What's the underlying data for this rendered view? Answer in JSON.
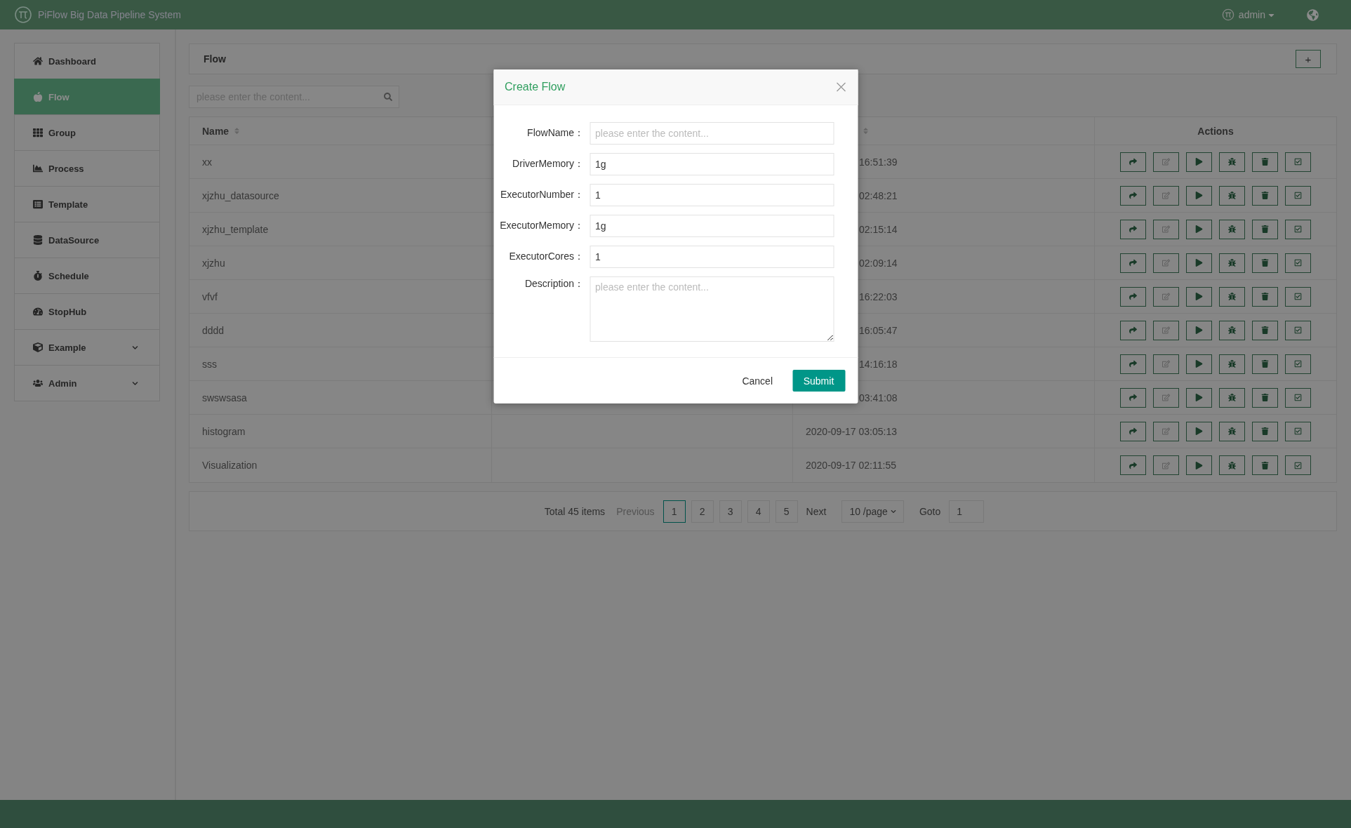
{
  "app": {
    "title": "PiFlow Big Data Pipeline System",
    "user": "admin"
  },
  "sidebar": {
    "items": [
      {
        "label": "Dashboard",
        "kind": "home",
        "selected": false,
        "expandable": false
      },
      {
        "label": "Flow",
        "kind": "flow",
        "selected": true,
        "expandable": false
      },
      {
        "label": "Group",
        "kind": "grid",
        "selected": false,
        "expandable": false
      },
      {
        "label": "Process",
        "kind": "chart",
        "selected": false,
        "expandable": false
      },
      {
        "label": "Template",
        "kind": "list",
        "selected": false,
        "expandable": false
      },
      {
        "label": "DataSource",
        "kind": "database",
        "selected": false,
        "expandable": false
      },
      {
        "label": "Schedule",
        "kind": "clock",
        "selected": false,
        "expandable": false
      },
      {
        "label": "StopHub",
        "kind": "gauge",
        "selected": false,
        "expandable": false
      },
      {
        "label": "Example",
        "kind": "cube",
        "selected": false,
        "expandable": true
      },
      {
        "label": "Admin",
        "kind": "users",
        "selected": false,
        "expandable": true
      }
    ]
  },
  "panel": {
    "title": "Flow",
    "add_button": "+"
  },
  "search": {
    "placeholder": "please enter the content..."
  },
  "table": {
    "columns": [
      {
        "label": "Name",
        "sortable": true
      },
      {
        "sortable": true
      },
      {
        "label": "Actions",
        "sortable": false
      }
    ],
    "row_actions": [
      {
        "kind": "share",
        "disabled": false
      },
      {
        "kind": "edit",
        "disabled": true
      },
      {
        "kind": "play",
        "disabled": false
      },
      {
        "kind": "bug",
        "disabled": false
      },
      {
        "kind": "trash",
        "disabled": false
      },
      {
        "kind": "check",
        "disabled": false
      }
    ],
    "rows": [
      {
        "name": "xx",
        "column_3": "16:51:39",
        "clipped": true
      },
      {
        "name": "xjzhu_datasource",
        "column_3": "02:48:21",
        "clipped": true
      },
      {
        "name": "xjzhu_template",
        "column_3": "02:15:14",
        "clipped": true
      },
      {
        "name": "xjzhu",
        "column_3": "02:09:14",
        "clipped": true
      },
      {
        "name": "vfvf",
        "column_3": "16:22:03",
        "clipped": true
      },
      {
        "name": "dddd",
        "column_3": "16:05:47",
        "clipped": true
      },
      {
        "name": "sss",
        "column_3": "14:16:18",
        "clipped": true
      },
      {
        "name": "swswsasa",
        "column_3": "03:41:08",
        "clipped": true
      },
      {
        "name": "histogram",
        "column_3": "2020-09-17 03:05:13",
        "clipped": false
      },
      {
        "name": "Visualization",
        "column_3": "2020-09-17 02:11:55",
        "clipped": false
      }
    ]
  },
  "pagination": {
    "total": "Total 45 items",
    "previous": {
      "label": "Previous",
      "disabled": true
    },
    "pages": [
      {
        "label": "1",
        "selected": true
      },
      {
        "label": "2",
        "selected": false
      },
      {
        "label": "3",
        "selected": false
      },
      {
        "label": "4",
        "selected": false
      },
      {
        "label": "5",
        "selected": false
      }
    ],
    "next": {
      "label": "Next",
      "disabled": false
    },
    "page_size": "10 /page",
    "goto_label": "Goto",
    "goto_value": "1"
  },
  "modal": {
    "title": "Create Flow",
    "fields": [
      {
        "kind": "input",
        "label": "FlowName：",
        "placeholder": "please enter the content..."
      },
      {
        "kind": "input",
        "label": "DriverMemory：",
        "value": "1g"
      },
      {
        "kind": "input",
        "label": "ExecutorNumber：",
        "value": "1"
      },
      {
        "kind": "input",
        "label": "ExecutorMemory：",
        "value": "1g"
      },
      {
        "kind": "input",
        "label": "ExecutorCores：",
        "value": "1"
      },
      {
        "kind": "textarea",
        "label": "Description：",
        "placeholder": "please enter the content..."
      }
    ],
    "cancel": "Cancel",
    "submit": "Submit"
  }
}
